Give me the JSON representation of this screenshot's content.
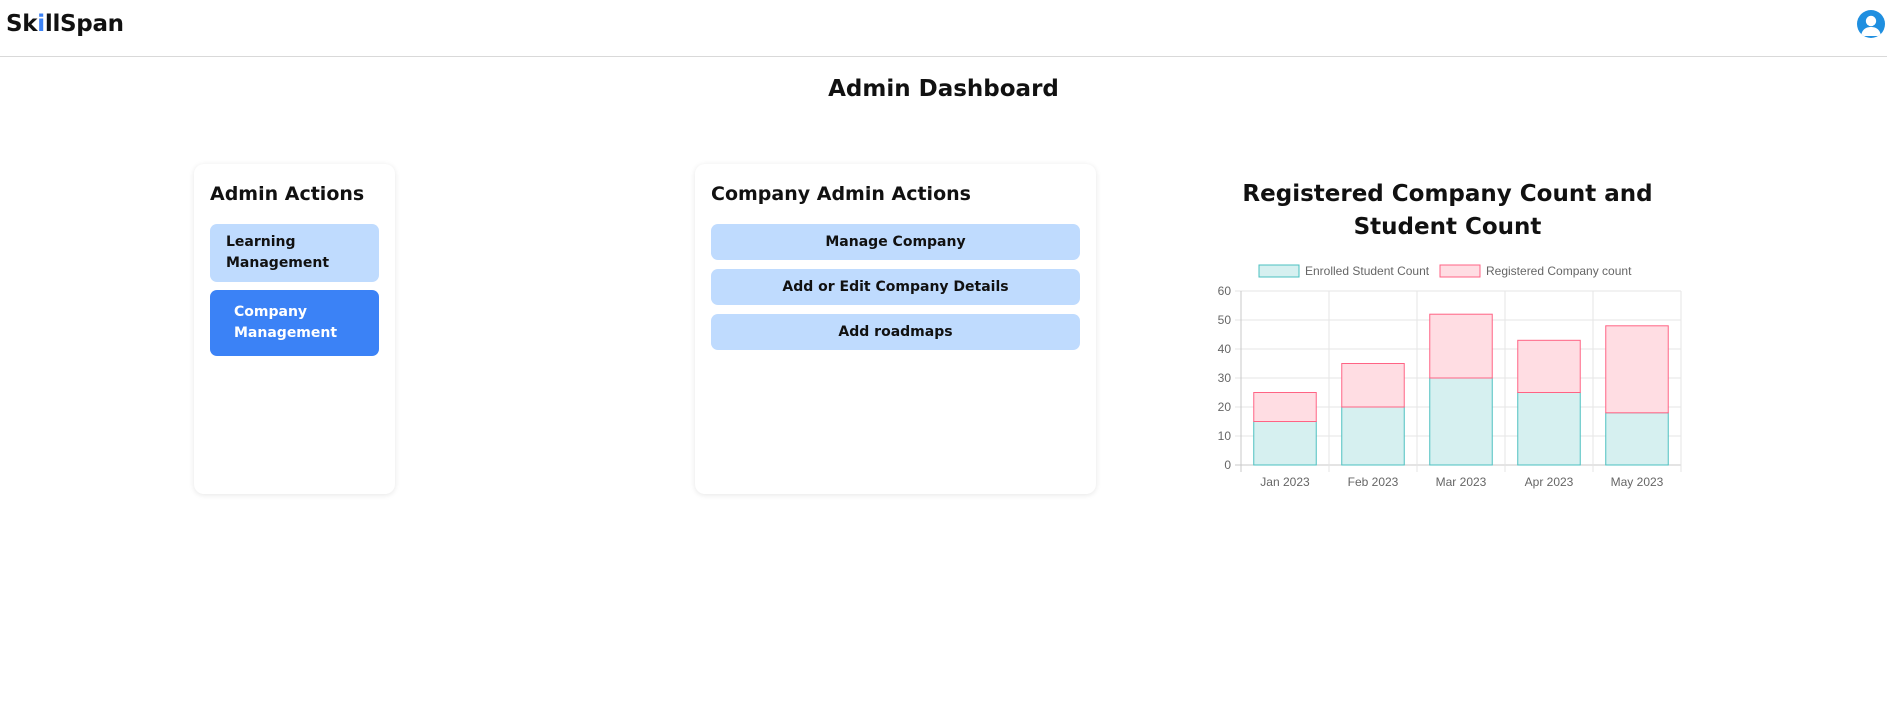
{
  "navbar": {
    "logo_pre": "Sk",
    "logo_accent": "i",
    "logo_post": "llSpan"
  },
  "page": {
    "title": "Admin Dashboard"
  },
  "admin_actions": {
    "title": "Admin Actions",
    "buttons": [
      {
        "label_line1": "Learning",
        "label_line2": "Management"
      },
      {
        "label_line1": "Company",
        "label_line2": "Management"
      }
    ]
  },
  "company_admin_actions": {
    "title": "Company Admin Actions",
    "buttons": [
      {
        "label": "Manage Company"
      },
      {
        "label": "Add or Edit Company Details"
      },
      {
        "label": "Add roadmaps"
      }
    ]
  },
  "colors": {
    "accent": "#3b82f6",
    "button_light": "#bfdbfe",
    "enrolled_fill": "#d6f0f0",
    "enrolled_stroke": "#4bc0c0",
    "company_fill": "#ffdde3",
    "company_stroke": "#ff6384"
  },
  "chart_data": {
    "type": "bar",
    "stacked": true,
    "title_line1": "Registered Company Count and",
    "title_line2": "Student Count",
    "categories": [
      "Jan 2023",
      "Feb 2023",
      "Mar 2023",
      "Apr 2023",
      "May 2023"
    ],
    "series": [
      {
        "name": "Enrolled Student Count",
        "values": [
          15,
          20,
          30,
          25,
          18
        ]
      },
      {
        "name": "Registered Company count",
        "values": [
          10,
          15,
          22,
          18,
          30
        ]
      }
    ],
    "ylim": [
      0,
      60
    ],
    "yticks": [
      "0",
      "10",
      "20",
      "30",
      "40",
      "50",
      "60"
    ],
    "legend_position": "top",
    "grid": true
  }
}
